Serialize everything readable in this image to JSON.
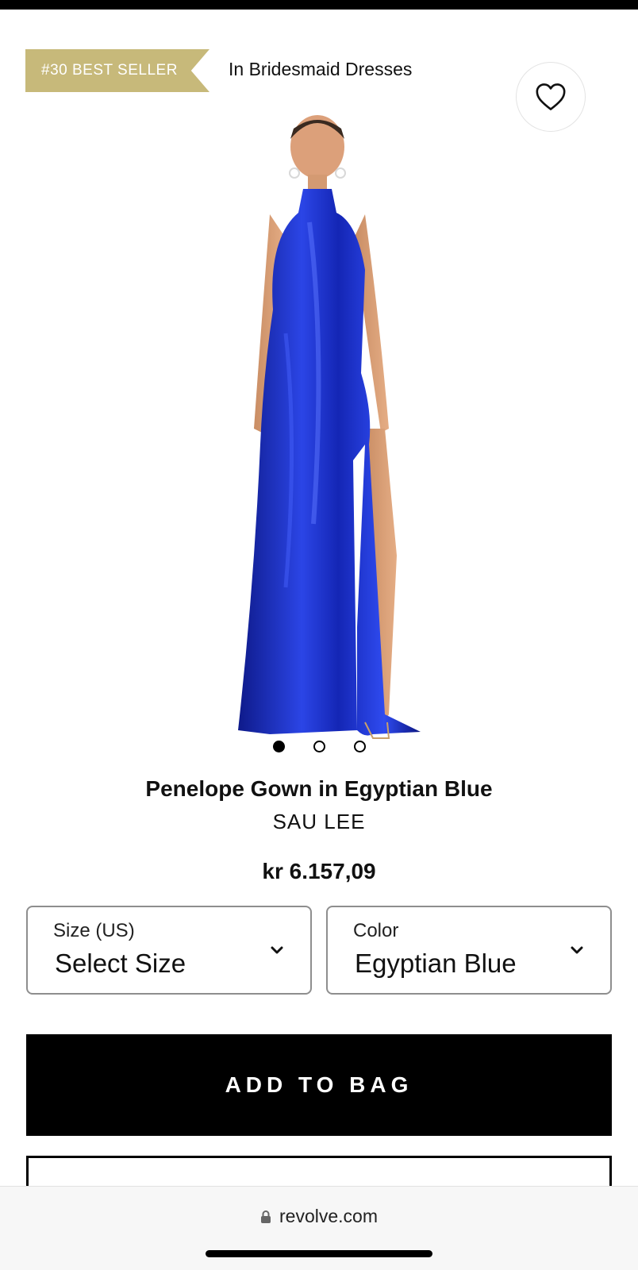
{
  "badge": {
    "rank_label": "#30 BEST SELLER",
    "category_text": "In Bridesmaid Dresses",
    "color": "#c7b97a"
  },
  "wishlist": {
    "icon": "heart-icon"
  },
  "carousel": {
    "dot_count": 3,
    "active_index": 0
  },
  "product": {
    "title": "Penelope Gown in Egyptian Blue",
    "brand": "SAU LEE",
    "price": "kr 6.157,09",
    "dress_color": "#1a2fc4"
  },
  "size_select": {
    "label": "Size (US)",
    "value": "Select Size",
    "icon": "chevron-down-icon"
  },
  "color_select": {
    "label": "Color",
    "value": "Egyptian Blue",
    "icon": "chevron-down-icon"
  },
  "actions": {
    "add_to_bag": "ADD TO BAG"
  },
  "browser": {
    "url": "revolve.com",
    "lock_icon": "lock-icon"
  }
}
